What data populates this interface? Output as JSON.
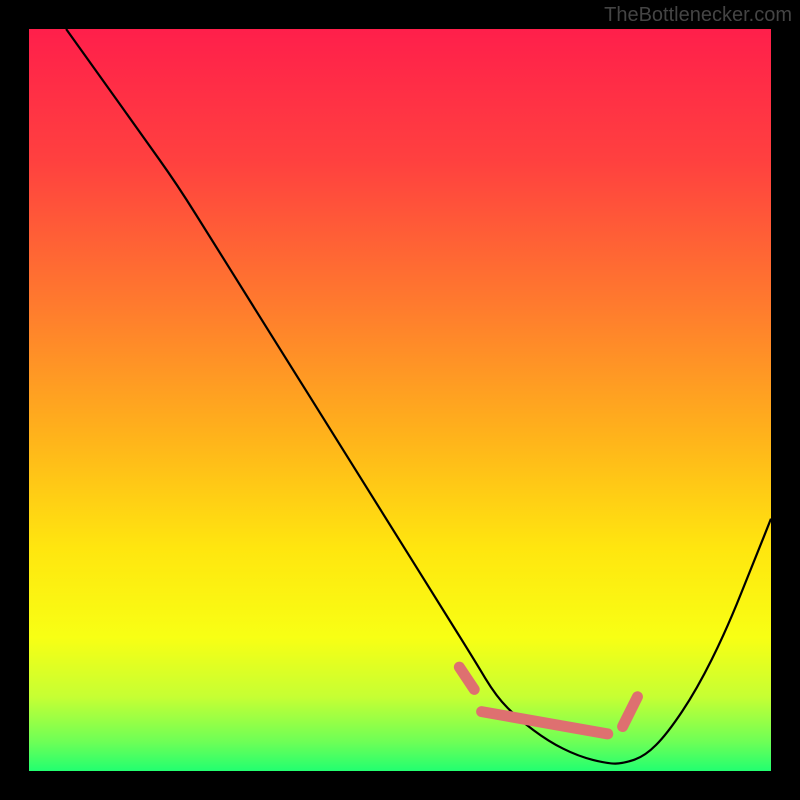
{
  "watermark": "TheBottlenecker.com",
  "chart_data": {
    "type": "line",
    "title": "",
    "xlabel": "",
    "ylabel": "",
    "xlim": [
      0,
      100
    ],
    "ylim": [
      0,
      100
    ],
    "gradient_stops": [
      {
        "offset": 0,
        "color": "#ff1f4b"
      },
      {
        "offset": 18,
        "color": "#ff413f"
      },
      {
        "offset": 38,
        "color": "#ff7d2d"
      },
      {
        "offset": 55,
        "color": "#ffb31b"
      },
      {
        "offset": 70,
        "color": "#ffe60f"
      },
      {
        "offset": 82,
        "color": "#f8ff14"
      },
      {
        "offset": 90,
        "color": "#c6ff33"
      },
      {
        "offset": 96,
        "color": "#6fff56"
      },
      {
        "offset": 100,
        "color": "#22ff70"
      }
    ],
    "curve": {
      "x": [
        5,
        10,
        15,
        20,
        25,
        30,
        35,
        40,
        45,
        50,
        55,
        60,
        63,
        66,
        70,
        74,
        78,
        80,
        83,
        86,
        90,
        94,
        98,
        100
      ],
      "y_top": [
        100,
        93,
        86,
        79,
        71,
        63,
        55,
        47,
        39,
        31,
        23,
        15,
        10,
        7,
        4,
        2,
        1,
        1,
        2,
        5,
        11,
        19,
        29,
        34
      ],
      "comment": "y_top is distance from bottom in percent; curve dips to ~1 around x=74-80 then rises"
    },
    "marker_band": {
      "color": "#de7070",
      "segments": [
        {
          "x0": 58,
          "y0": 14,
          "x1": 60,
          "y1": 11
        },
        {
          "x0": 61,
          "y0": 8,
          "x1": 78,
          "y1": 5
        },
        {
          "x0": 80,
          "y0": 6,
          "x1": 82,
          "y1": 10
        }
      ]
    }
  }
}
